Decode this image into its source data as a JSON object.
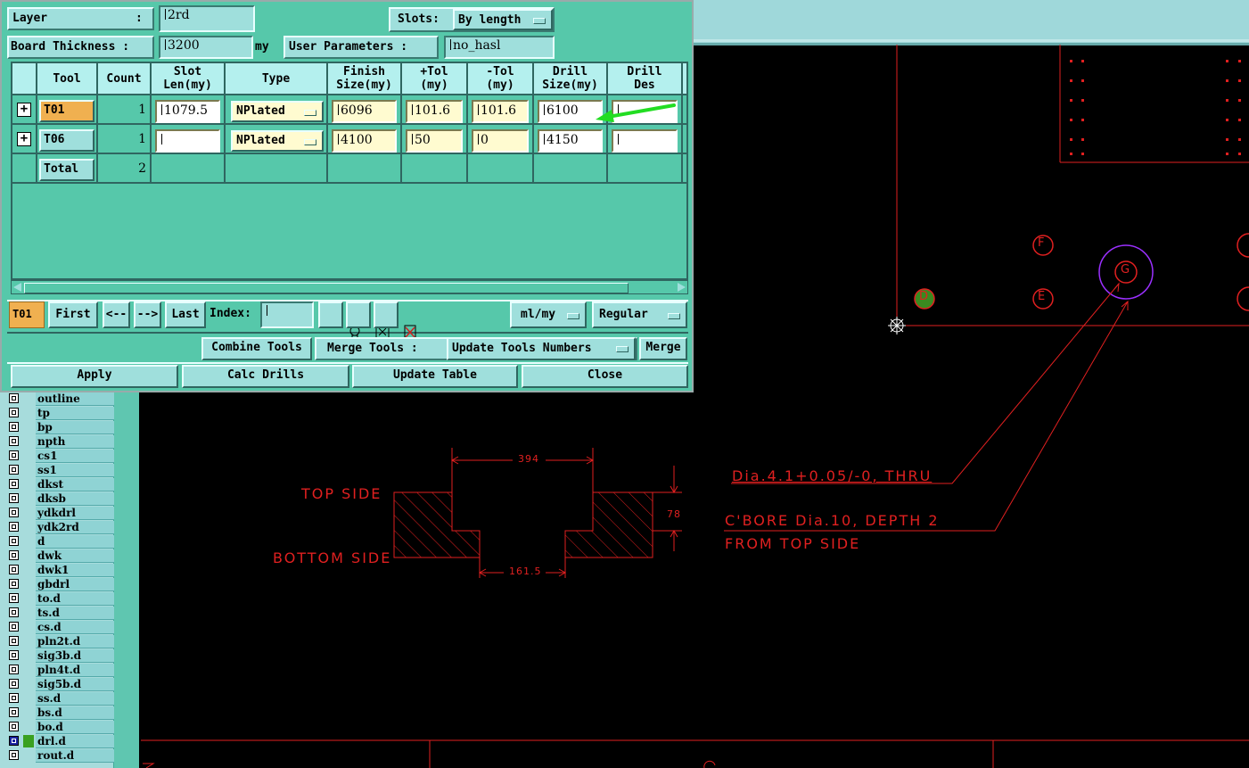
{
  "dialog": {
    "layer_label": "Layer",
    "layer_colon": ":",
    "layer_value": "2rd",
    "slots_label": "Slots:",
    "slots_value": "By length",
    "board_thickness_label": "Board Thickness :",
    "board_thickness_value": "3200",
    "board_thickness_unit": "my",
    "user_params_label": "User Parameters :",
    "user_params_value": "no_hasl",
    "columns": [
      "Tool",
      "Count",
      "Slot\nLen(my)",
      "Type",
      "Finish\nSize(my)",
      "+Tol\n(my)",
      "-Tol\n(my)",
      "Drill\nSize(my)",
      "Drill\nDes"
    ],
    "rows": [
      {
        "tool": "T01",
        "count": "1",
        "slot_len": "1079.5",
        "type": "NPlated",
        "finish": "6096",
        "plus_tol": "101.6",
        "minus_tol": "101.6",
        "drill": "6100",
        "drill_des": ""
      },
      {
        "tool": "T06",
        "count": "1",
        "slot_len": "",
        "type": "NPlated",
        "finish": "4100",
        "plus_tol": "50",
        "minus_tol": "0",
        "drill": "4150",
        "drill_des": ""
      }
    ],
    "total_label": "Total",
    "total_count": "2",
    "nav": {
      "current_tool": "T01",
      "first": "First",
      "prev": "<--",
      "next": "-->",
      "last": "Last",
      "index_label": "Index:",
      "index_value": "",
      "units": "ml/my",
      "mode": "Regular"
    },
    "combine_tools": "Combine Tools",
    "merge_tools_label": "Merge Tools :",
    "merge_mode": "Update Tools Numbers",
    "merge_button": "Merge",
    "apply": "Apply",
    "calc_drills": "Calc Drills",
    "update_table": "Update Table",
    "close": "Close"
  },
  "layers": [
    {
      "name": "outline"
    },
    {
      "name": "tp"
    },
    {
      "name": "bp"
    },
    {
      "name": "npth"
    },
    {
      "name": "cs1"
    },
    {
      "name": "ss1"
    },
    {
      "name": "dkst"
    },
    {
      "name": "dksb"
    },
    {
      "name": "ydkdrl"
    },
    {
      "name": "ydk2rd"
    },
    {
      "name": "d"
    },
    {
      "name": "dwk"
    },
    {
      "name": "dwk1"
    },
    {
      "name": "gbdrl"
    },
    {
      "name": "to.d"
    },
    {
      "name": "ts.d"
    },
    {
      "name": "cs.d"
    },
    {
      "name": "pln2t.d"
    },
    {
      "name": "sig3b.d"
    },
    {
      "name": "pln4t.d"
    },
    {
      "name": "sig5b.d"
    },
    {
      "name": "ss.d"
    },
    {
      "name": "bs.d"
    },
    {
      "name": "bo.d"
    },
    {
      "name": "drl.d"
    },
    {
      "name": "rout.d"
    }
  ],
  "drawing": {
    "top_side": "TOP SIDE",
    "bottom_side": "BOTTOM SIDE",
    "dim_top": "394",
    "dim_bottom": "161.5",
    "dim_right": "78",
    "note1": "Dia.4.1+0.05/-0, THRU",
    "note2": "C'BORE Dia.10, DEPTH 2",
    "note3": "FROM TOP SIDE",
    "markers": [
      "F",
      "G",
      "D",
      "E"
    ]
  },
  "colors": {
    "drawing_red": "#e02020",
    "highlight": "#f0b050",
    "arrow": "#22dd22",
    "circle": "#9b30ff"
  }
}
